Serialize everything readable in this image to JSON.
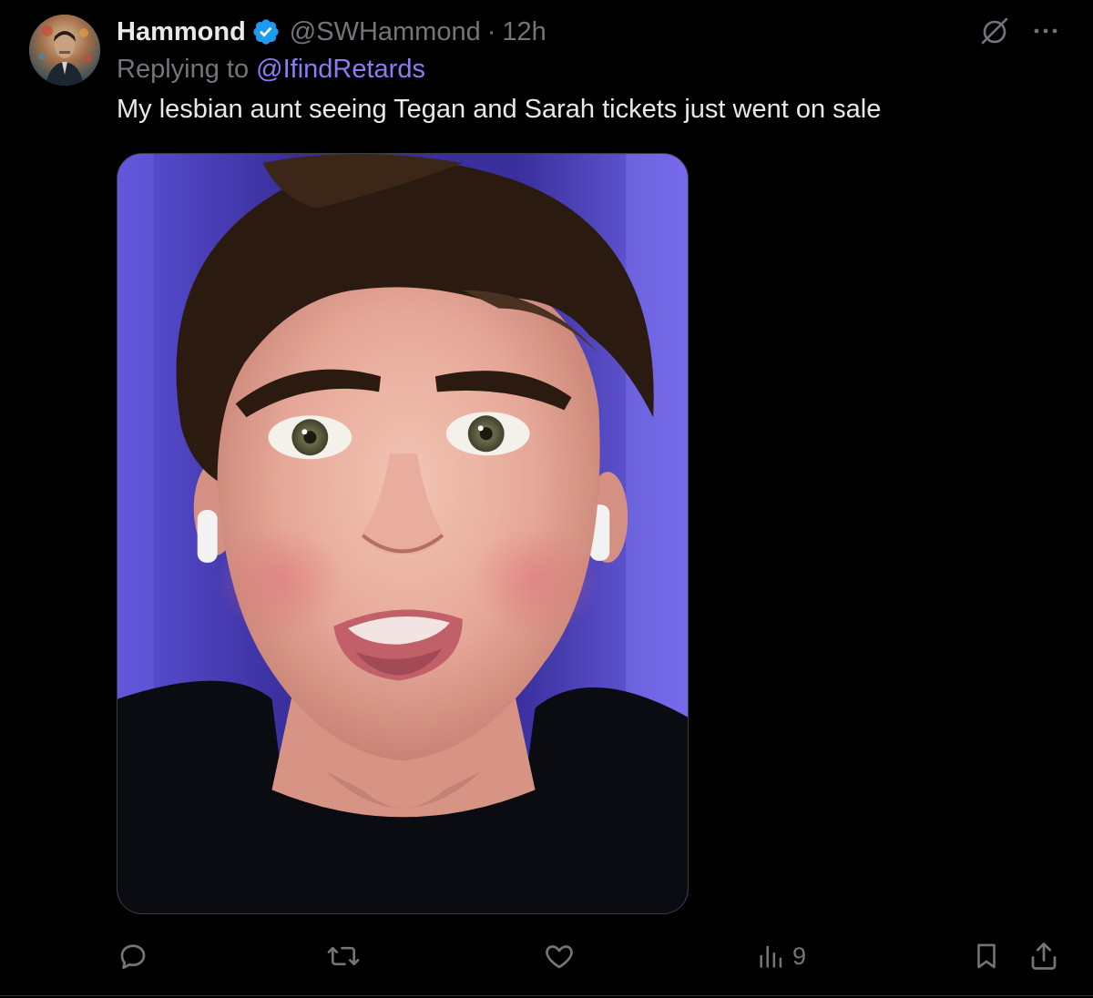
{
  "author": {
    "display_name": "Hammond",
    "handle": "@SWHammond",
    "separator": "·",
    "time": "12h",
    "verified": true,
    "avatar_icon": "avatar-portrait"
  },
  "reply": {
    "prefix": "Replying to ",
    "mention": "@IfindRetards"
  },
  "tweet": {
    "text": "My lesbian aunt seeing Tegan and Sarah tickets just went on sale"
  },
  "media": {
    "type": "photo",
    "subject": "photo"
  },
  "top_icons": [
    "grok-icon",
    "more-icon"
  ],
  "actions": {
    "reply": {
      "icon": "reply-icon",
      "count": ""
    },
    "repost": {
      "icon": "repost-icon",
      "count": ""
    },
    "like": {
      "icon": "like-icon",
      "count": ""
    },
    "views": {
      "icon": "views-icon",
      "count": "9"
    },
    "bookmark": {
      "icon": "bookmark-icon"
    },
    "share": {
      "icon": "share-icon"
    }
  },
  "colors": {
    "background": "#000000",
    "primary_text": "#e7e9ea",
    "secondary_text": "#71767b",
    "mention": "#8b7cf6",
    "verified_badge": "#1d9bf0"
  }
}
